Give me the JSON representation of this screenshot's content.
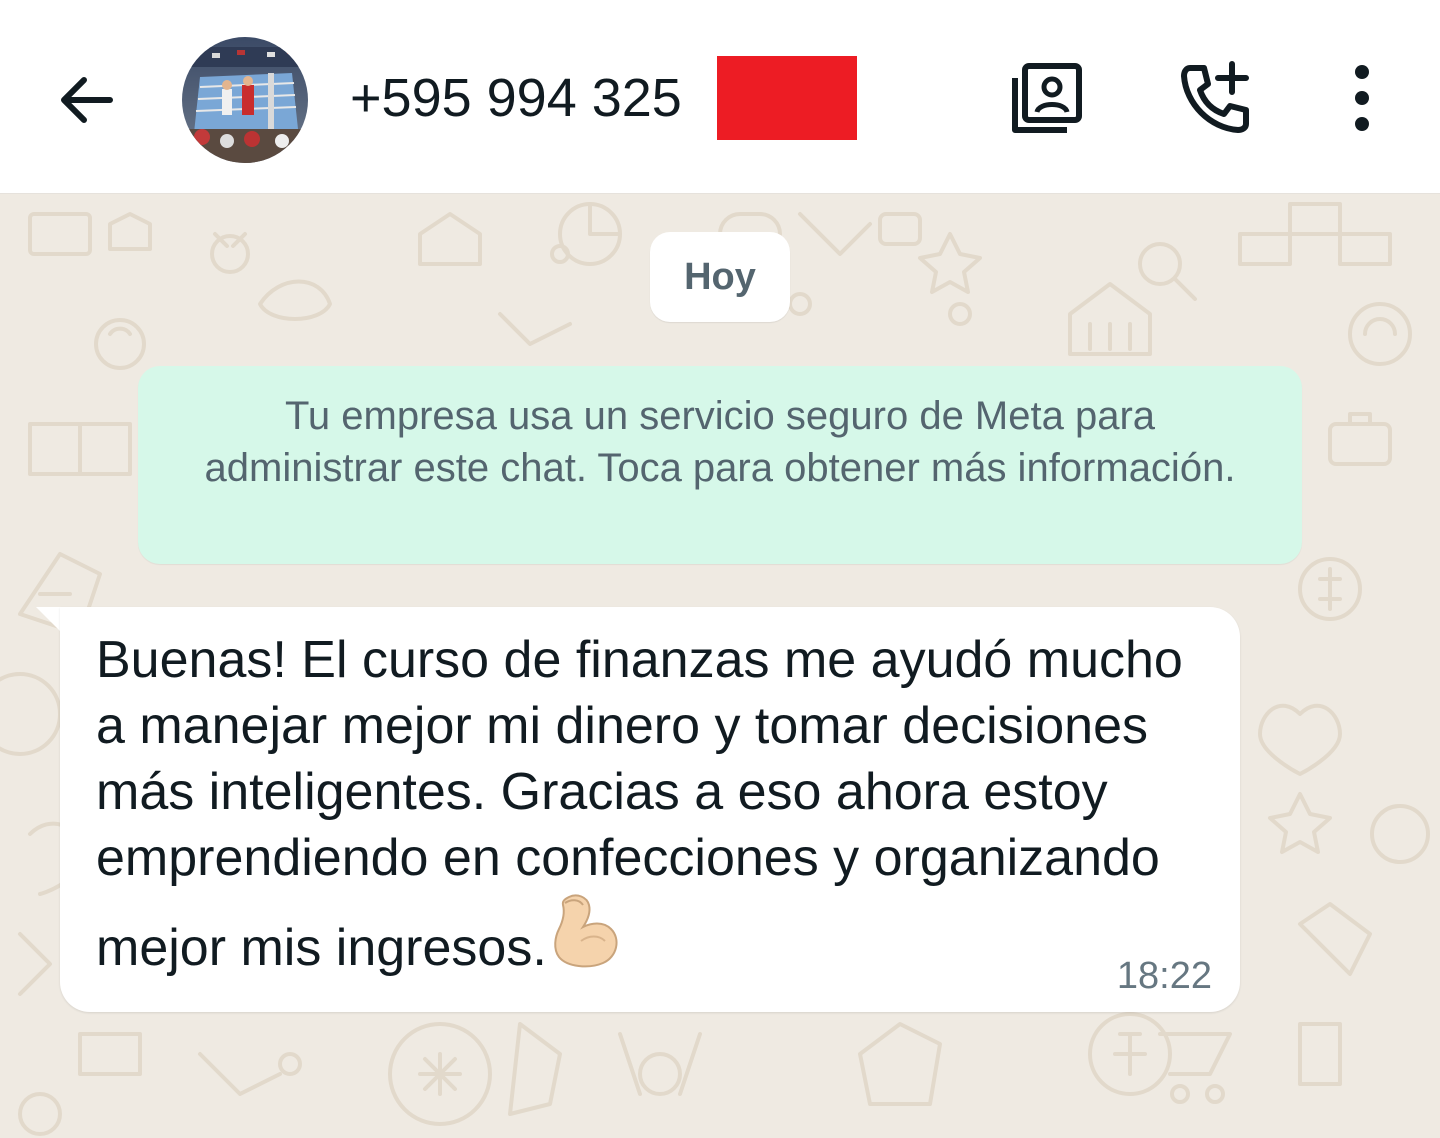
{
  "header": {
    "contact_name": "+595 994 325",
    "back_icon": "arrow-left-icon",
    "contact_card_icon": "contact-card-icon",
    "add_call_icon": "add-call-icon",
    "more_icon": "more-vertical-icon",
    "redaction_color": "#ed1c24"
  },
  "chat": {
    "date_label": "Hoy",
    "system_notice": "Tu empresa usa un servicio seguro de Meta para administrar este chat. Toca para obtener más información.",
    "messages": [
      {
        "text": "Buenas! El curso de finanzas me ayudó mucho a manejar mejor mi dinero y tomar decisiones más inteligentes. Gracias a eso ahora estoy emprendiendo en confecciones y organizando mejor mis ingresos.",
        "emoji": "flexed-biceps",
        "time": "18:22"
      }
    ]
  },
  "colors": {
    "wallpaper": "#efeae2",
    "notice_bg": "#d6f8e9",
    "bubble_bg": "#ffffff"
  }
}
